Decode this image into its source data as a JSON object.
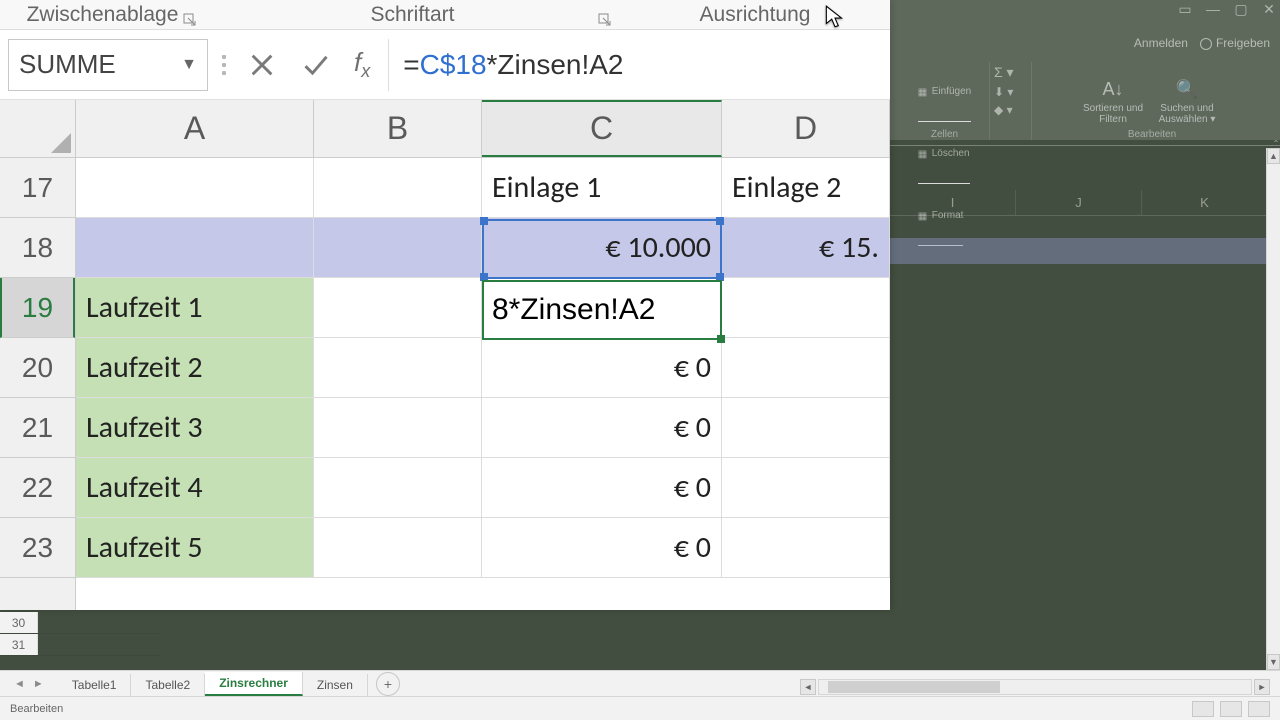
{
  "ribbon_groups": {
    "clipboard": "Zwischenablage",
    "font": "Schriftart",
    "alignment": "Ausrichtung"
  },
  "top_right": {
    "sign_in": "Anmelden",
    "share": "Freigeben"
  },
  "ribbon_right": {
    "cells": {
      "insert": "Einfügen",
      "delete": "Löschen",
      "format": "Format",
      "group": "Zellen"
    },
    "editing": {
      "sort": "Sortieren und Filtern",
      "find": "Suchen und Auswählen",
      "group": "Bearbeiten"
    }
  },
  "formula_bar": {
    "name_box": "SUMME",
    "formula_prefix": "=",
    "formula_ref": "C$18",
    "formula_rest": "*Zinsen!A2"
  },
  "columns": {
    "A": "A",
    "B": "B",
    "C": "C",
    "D": "D"
  },
  "bg_columns": {
    "I": "I",
    "J": "J",
    "K": "K"
  },
  "rows": {
    "r17": "17",
    "r18": "18",
    "r19": "19",
    "r20": "20",
    "r21": "21",
    "r22": "22",
    "r23": "23",
    "r30": "30",
    "r31": "31"
  },
  "cells": {
    "C17": "Einlage 1",
    "D17": "Einlage 2",
    "C18": "€ 10.000",
    "D18": "€ 15.",
    "A19": "Laufzeit 1",
    "C19_edit": "8*Zinsen!A2",
    "A20": "Laufzeit 2",
    "C20": "€ 0",
    "A21": "Laufzeit 3",
    "C21": "€ 0",
    "A22": "Laufzeit 4",
    "C22": "€ 0",
    "A23": "Laufzeit 5",
    "C23": "€ 0"
  },
  "tabs": {
    "t1": "Tabelle1",
    "t2": "Tabelle2",
    "t3": "Zinsrechner",
    "t4": "Zinsen"
  },
  "status": {
    "mode": "Bearbeiten"
  }
}
